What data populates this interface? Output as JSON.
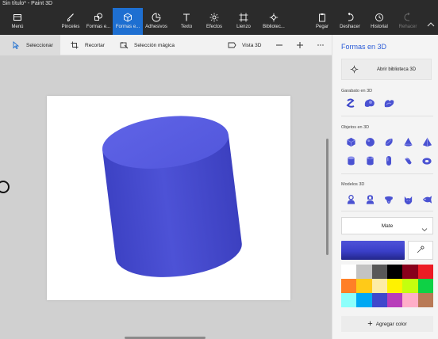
{
  "window": {
    "title": "Sin título* - Paint 3D"
  },
  "toolbar": {
    "items": [
      {
        "id": "menu",
        "label": "Menú",
        "icon": "folder-icon",
        "active": false,
        "enabled": true
      },
      {
        "id": "brushes",
        "label": "Pinceles",
        "icon": "brush-icon",
        "active": false,
        "enabled": true
      },
      {
        "id": "shapes2d",
        "label": "Formas e...",
        "icon": "shapes2d-icon",
        "active": false,
        "enabled": true
      },
      {
        "id": "shapes3d",
        "label": "Formas e...",
        "icon": "cube-icon",
        "active": true,
        "enabled": true
      },
      {
        "id": "stickers",
        "label": "Adhesivos",
        "icon": "sticker-icon",
        "active": false,
        "enabled": true
      },
      {
        "id": "text",
        "label": "Texto",
        "icon": "text-icon",
        "active": false,
        "enabled": true
      },
      {
        "id": "effects",
        "label": "Efectos",
        "icon": "effects-icon",
        "active": false,
        "enabled": true
      },
      {
        "id": "canvas",
        "label": "Lienzo",
        "icon": "canvas-icon",
        "active": false,
        "enabled": true
      },
      {
        "id": "library",
        "label": "Bibliotec...",
        "icon": "library-icon",
        "active": false,
        "enabled": true
      },
      {
        "id": "paste",
        "label": "Pegar",
        "icon": "paste-icon",
        "active": false,
        "enabled": true
      },
      {
        "id": "undo",
        "label": "Deshacer",
        "icon": "undo-icon",
        "active": false,
        "enabled": true
      },
      {
        "id": "history",
        "label": "Historial",
        "icon": "history-icon",
        "active": false,
        "enabled": true
      },
      {
        "id": "redo",
        "label": "Rehacer",
        "icon": "redo-icon",
        "active": false,
        "enabled": false
      }
    ]
  },
  "subtoolbar": {
    "select_label": "Seleccionar",
    "crop_label": "Recortar",
    "magic_select_label": "Selección mágica",
    "view3d_label": "Vista 3D"
  },
  "panel": {
    "title": "Formas en 3D",
    "library_button": "Abrir biblioteca 3D",
    "doodle_label": "Garabato en 3D",
    "objects_label": "Objetos en 3D",
    "models_label": "Modelos 3D",
    "doodle_tools": [
      "sharp-doodle-icon",
      "soft-doodle-icon",
      "tube-doodle-icon"
    ],
    "objects": [
      "cube-icon",
      "sphere-icon",
      "hemisphere-icon",
      "cone-icon",
      "pyramid-icon",
      "cylinder-icon",
      "tube-icon",
      "capsule-icon",
      "donut-icon",
      "torus-icon"
    ],
    "models": [
      "man-model-icon",
      "woman-model-icon",
      "dog-model-icon",
      "cat-model-icon",
      "fish-model-icon"
    ],
    "material": "Mate",
    "add_color_label": "Agregar color"
  },
  "colors": {
    "accent": "#1e6fd1",
    "current_color": "#4f52d8",
    "shape_color": "#5055d6",
    "palette": [
      "#ffffff",
      "#c3c3c3",
      "#585858",
      "#000000",
      "#88001b",
      "#ec1c24",
      "#ff7f27",
      "#ffca18",
      "#fdeca6",
      "#fff200",
      "#c4ff0e",
      "#0ed145",
      "#8cfffb",
      "#00a8f3",
      "#3f48cc",
      "#b83dba",
      "#ffaec8",
      "#b97a56"
    ]
  }
}
